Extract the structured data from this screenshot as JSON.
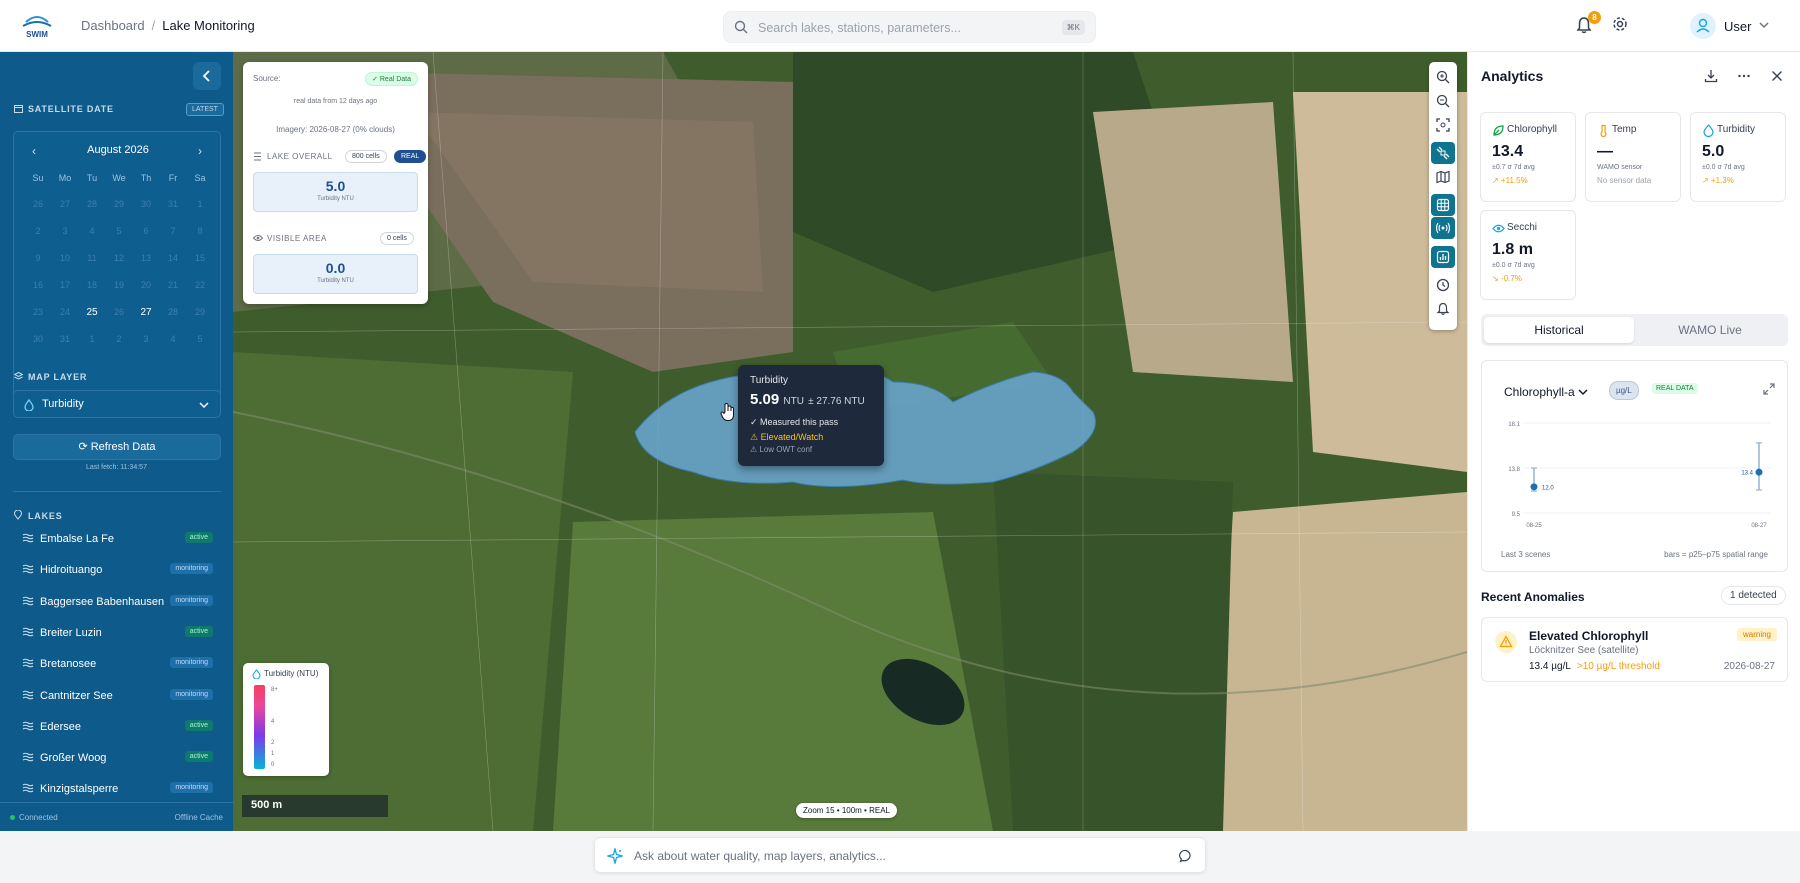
{
  "header": {
    "logo_text": "SWIM",
    "breadcrumb": [
      "Dashboard",
      "Lake Monitoring"
    ],
    "search_placeholder": "Search lakes, stations, parameters...",
    "search_shortcut": "⌘K",
    "notifications_count": "8",
    "user_name": "User"
  },
  "sidebar": {
    "satellite_date_label": "SATELLITE DATE",
    "latest_badge": "LATEST",
    "calendar": {
      "month": "August 2026",
      "weekdays": [
        "Su",
        "Mo",
        "Tu",
        "We",
        "Th",
        "Fr",
        "Sa"
      ],
      "weeks": [
        [
          "26",
          "27",
          "28",
          "29",
          "30",
          "31",
          "1"
        ],
        [
          "2",
          "3",
          "4",
          "5",
          "6",
          "7",
          "8"
        ],
        [
          "9",
          "10",
          "11",
          "12",
          "13",
          "14",
          "15"
        ],
        [
          "16",
          "17",
          "18",
          "19",
          "20",
          "21",
          "22"
        ],
        [
          "23",
          "24",
          "25",
          "26",
          "27",
          "28",
          "29"
        ],
        [
          "30",
          "31",
          "1",
          "2",
          "3",
          "4",
          "5"
        ]
      ],
      "highlighted": [
        "25",
        "27"
      ]
    },
    "map_layer_label": "MAP LAYER",
    "map_layer_value": "Turbidity",
    "refresh_label": "Refresh Data",
    "last_fetch": "Last fetch: 11:34:57",
    "lakes_label": "LAKES",
    "lakes": [
      {
        "name": "Embalse La Fe",
        "status": "active"
      },
      {
        "name": "Hidroituango",
        "status": "monitoring"
      },
      {
        "name": "Baggersee Babenhausen",
        "status": "monitoring"
      },
      {
        "name": "Breiter Luzin",
        "status": "active"
      },
      {
        "name": "Bretanosee",
        "status": "monitoring"
      },
      {
        "name": "Cantnitzer See",
        "status": "monitoring"
      },
      {
        "name": "Edersee",
        "status": "active"
      },
      {
        "name": "Großer Woog",
        "status": "active"
      },
      {
        "name": "Kinzigstalsperre",
        "status": "monitoring"
      }
    ],
    "footer_connected": "Connected",
    "footer_cache": "Offline Cache"
  },
  "map": {
    "source_label": "Source:",
    "source_badge": "✓ Real Data",
    "real_data_age": "real data from 12 days ago",
    "imagery": "Imagery: 2026-08-27 (0% clouds)",
    "lake_overall_label": "LAKE OVERALL",
    "lake_overall_cells": "800 cells",
    "lake_overall_badge": "REAL",
    "lake_overall_value": "5.0",
    "lake_overall_unit": "Turbidity NTU",
    "visible_area_label": "VISIBLE AREA",
    "visible_area_cells": "0 cells",
    "visible_area_value": "0.0",
    "visible_area_unit": "Turbidity NTU",
    "tooltip": {
      "title": "Turbidity",
      "value": "5.09",
      "unit": "NTU",
      "uncertainty": "± 27.76 NTU",
      "line1": "✓ Measured this pass",
      "line2": "⚠ Elevated/Watch",
      "line3": "⚠ Low OWT conf"
    },
    "legend": {
      "title": "Turbidity (NTU)",
      "ticks": [
        "8+",
        "4",
        "2",
        "1",
        "0"
      ]
    },
    "scale_label": "500 m",
    "zoom_info": "Zoom 15 • 100m • REAL"
  },
  "analytics": {
    "title": "Analytics",
    "cards": [
      {
        "name": "Chlorophyll",
        "value": "13.4",
        "sub": "±0.7 σ 7d avg",
        "trend": "↗ +11.5%",
        "icon": "leaf-icon",
        "color": "#16a34a"
      },
      {
        "name": "Temp",
        "value": "—",
        "sub": "WAMO sensor",
        "trend": "No sensor data",
        "icon": "thermometer-icon",
        "color": "#f59e0b"
      },
      {
        "name": "Turbidity",
        "value": "5.0",
        "sub": "±0.0 σ 7d avg",
        "trend": "↗ +1.3%",
        "icon": "droplet-icon",
        "color": "#0ea5e9"
      },
      {
        "name": "Secchi",
        "value": "1.8 m",
        "sub": "±0.0 σ 7d avg",
        "trend": "↘ -0.7%",
        "icon": "eye-icon",
        "color": "#0ea5e9"
      }
    ],
    "tabs": [
      "Historical",
      "WAMO Live"
    ],
    "chart_title": "Chlorophyll-a",
    "chart_unit": "µg/L",
    "chart_badge": "REAL DATA",
    "chart_footer_left": "Last 3 scenes",
    "chart_footer_right": "bars = p25–p75 spatial range",
    "anomalies_title": "Recent Anomalies",
    "anomalies_count": "1 detected",
    "anomaly": {
      "title": "Elevated Chlorophyll",
      "location": "Löcknitzer See (satellite)",
      "value": "13.4 µg/L",
      "threshold": ">10 µg/L threshold",
      "date": "2026-08-27",
      "severity": "warning"
    }
  },
  "chart_data": {
    "type": "scatter",
    "title": "Chlorophyll-a",
    "xlabel": "",
    "ylabel": "µg/L",
    "x_ticks": [
      "08-25",
      "08-27"
    ],
    "y_ticks": [
      9.5,
      13.8,
      18.1
    ],
    "ylim": [
      9.5,
      18.1
    ],
    "points": [
      {
        "x": "08-25",
        "y": 12.0,
        "p25": 11.6,
        "p75": 13.8
      },
      {
        "x": "08-27",
        "y": 13.4,
        "p25": 11.7,
        "p75": 16.2
      }
    ]
  },
  "assistant": {
    "placeholder": "Ask about water quality, map layers, analytics..."
  }
}
